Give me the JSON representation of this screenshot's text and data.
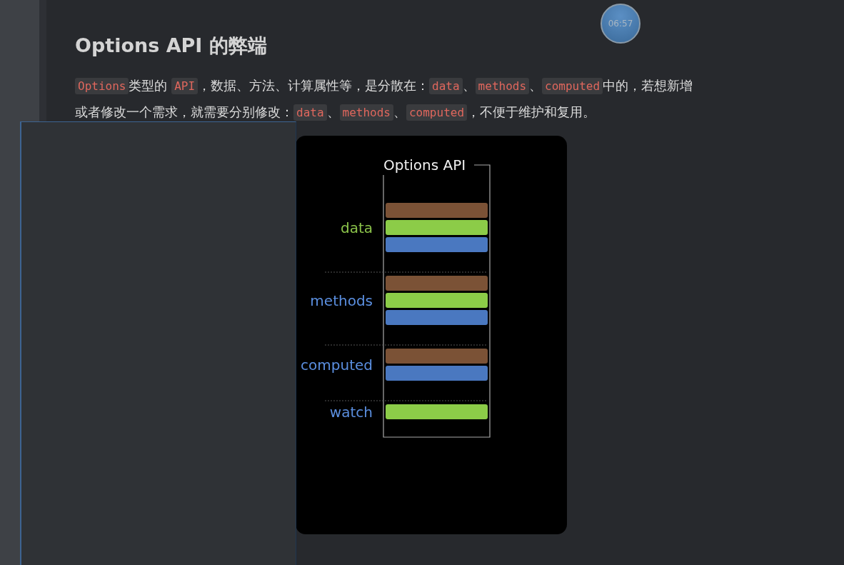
{
  "timer": "06:57",
  "heading": "Options API 的弊端",
  "paragraph": [
    [
      {
        "kind": "code",
        "text": "Options"
      },
      {
        "kind": "text",
        "text": "类型的 "
      },
      {
        "kind": "code",
        "text": "API"
      },
      {
        "kind": "text",
        "text": "，数据、方法、计算属性等，是分散在："
      },
      {
        "kind": "code",
        "text": "data"
      },
      {
        "kind": "text",
        "text": "、"
      },
      {
        "kind": "code",
        "text": "methods"
      },
      {
        "kind": "text",
        "text": "、"
      },
      {
        "kind": "code",
        "text": "computed"
      },
      {
        "kind": "text",
        "text": "中的，若想新增"
      }
    ],
    [
      {
        "kind": "text",
        "text": "或者修改一个需求，就需要分别修改："
      },
      {
        "kind": "code",
        "text": "data"
      },
      {
        "kind": "text",
        "text": "、"
      },
      {
        "kind": "code",
        "text": "methods"
      },
      {
        "kind": "text",
        "text": "、"
      },
      {
        "kind": "code",
        "text": "computed"
      },
      {
        "kind": "text",
        "text": "，不便于维护和复用。"
      }
    ]
  ],
  "diagram": {
    "title": "Options API",
    "groups": [
      {
        "label": "data",
        "color": "#8bc34a",
        "bars": [
          {
            "color": "#7b5236"
          },
          {
            "color": "#8ccc48"
          },
          {
            "color": "#4a78c0"
          }
        ]
      },
      {
        "label": "methods",
        "color": "#5b8fe0",
        "bars": [
          {
            "color": "#7b5236"
          },
          {
            "color": "#8ccc48"
          },
          {
            "color": "#4a78c0"
          }
        ]
      },
      {
        "label": "computed",
        "color": "#5b8fe0",
        "bars": [
          {
            "color": "#7b5236"
          },
          {
            "color": "#4a78c0"
          }
        ]
      },
      {
        "label": "watch",
        "color": "#5b8fe0",
        "bars": [
          {
            "color": "#8ccc48"
          }
        ]
      }
    ]
  }
}
